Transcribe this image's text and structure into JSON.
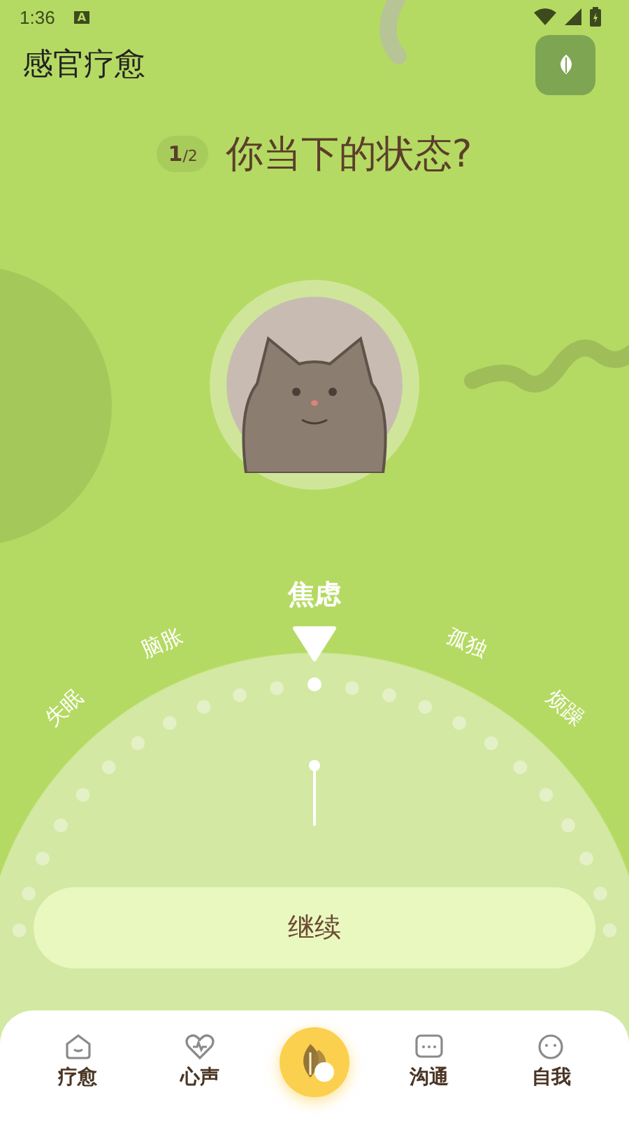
{
  "status_bar": {
    "time": "1:36",
    "badge": "A"
  },
  "header": {
    "title": "感官疗愈"
  },
  "question": {
    "step_current": "1",
    "step_total": "/2",
    "text": "你当下的状态?"
  },
  "dial": {
    "options": [
      {
        "label": "失眠",
        "selected": false
      },
      {
        "label": "脑胀",
        "selected": false
      },
      {
        "label": "焦虑",
        "selected": true
      },
      {
        "label": "孤独",
        "selected": false
      },
      {
        "label": "烦躁",
        "selected": false
      }
    ]
  },
  "continue_button": {
    "label": "继续"
  },
  "tab_bar": {
    "tabs": [
      {
        "label": "疗愈",
        "kind": "house"
      },
      {
        "label": "心声",
        "kind": "heart"
      },
      {
        "kind": "center"
      },
      {
        "label": "沟通",
        "kind": "chat"
      },
      {
        "label": "自我",
        "kind": "face"
      }
    ]
  }
}
